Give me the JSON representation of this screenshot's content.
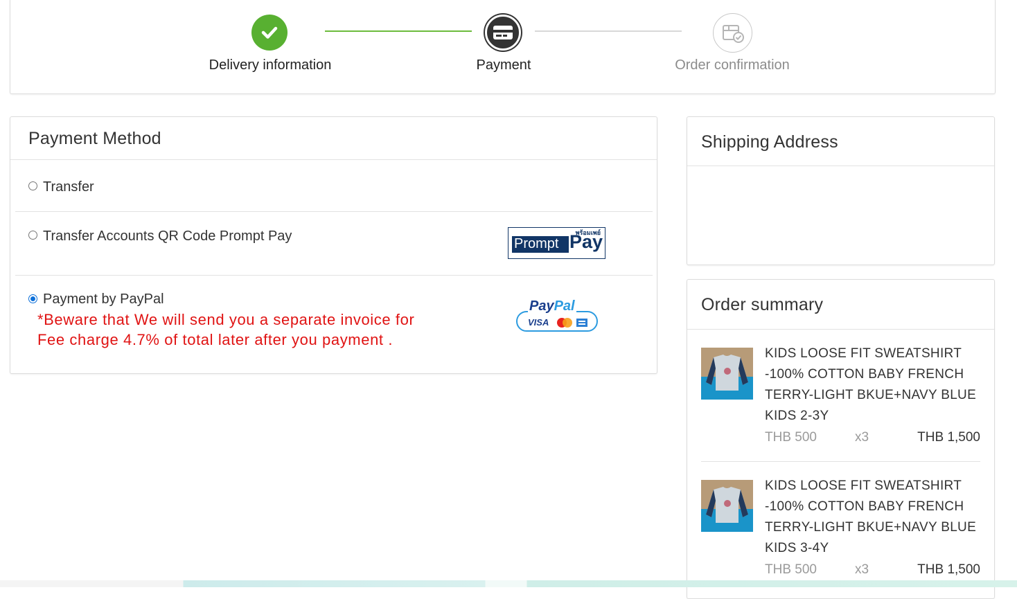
{
  "stepper": {
    "steps": [
      {
        "label": "Delivery information",
        "state": "done"
      },
      {
        "label": "Payment",
        "state": "active"
      },
      {
        "label": "Order confirmation",
        "state": "pending"
      }
    ],
    "colors": {
      "done": "#58b031",
      "active": "#333333",
      "pending": "#b5b5b5"
    }
  },
  "payment": {
    "title": "Payment Method",
    "options": [
      {
        "label": "Transfer",
        "selected": false
      },
      {
        "label": "Transfer Accounts QR Code Prompt Pay",
        "selected": false,
        "logo": "promptpay-logo"
      },
      {
        "label": "Payment by PayPal",
        "selected": true,
        "logo": "paypal-logo"
      }
    ],
    "warning_line1": "*Beware that We will send you a separate invoice for",
    "warning_line2": "Fee charge 4.7% of total later after you payment .",
    "promptpay": {
      "thai": "พร้อมเพย์",
      "word1": "Prompt",
      "word2": "Pay"
    },
    "paypal": {
      "word1": "Pay",
      "word2": "Pal",
      "visa": "VISA"
    }
  },
  "shipping": {
    "title": "Shipping Address"
  },
  "summary": {
    "title": "Order summary",
    "items": [
      {
        "name_lines": [
          "KIDS LOOSE FIT SWEATSHIRT",
          "-100% COTTON BABY FRENCH",
          "TERRY-LIGHT BKUE+NAVY BLUE",
          "KIDS 2-3Y"
        ],
        "price": "THB 500",
        "qty": "x3",
        "total": "THB 1,500"
      },
      {
        "name_lines": [
          "KIDS LOOSE FIT SWEATSHIRT",
          "-100% COTTON BABY FRENCH",
          "TERRY-LIGHT BKUE+NAVY BLUE",
          "KIDS 3-4Y"
        ],
        "price": "THB 500",
        "qty": "x3",
        "total": "THB 1,500"
      }
    ]
  },
  "colors": {
    "warning": "#e01313",
    "radio_selected": "#0b6fd9",
    "promptpay_navy": "#113566",
    "paypal_blue": "#1a3e8c"
  }
}
